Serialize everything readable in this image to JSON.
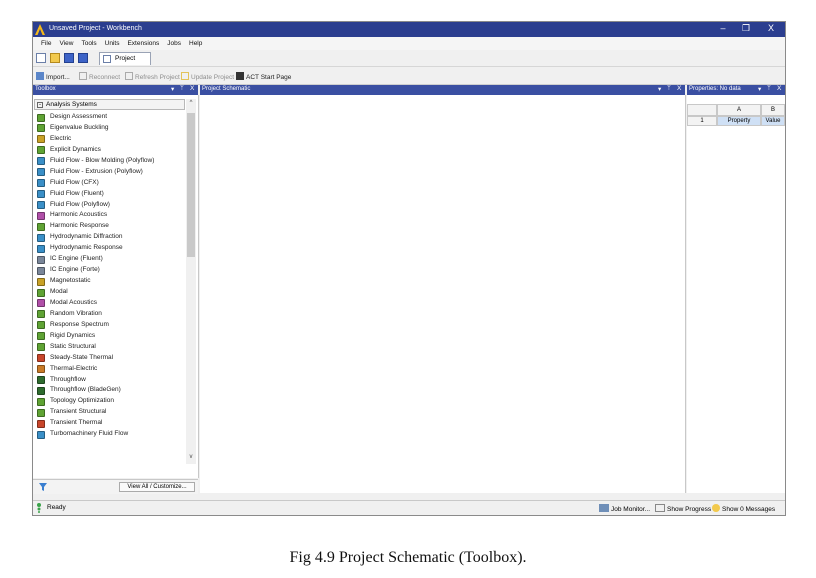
{
  "window": {
    "title": "Unsaved Project - Workbench",
    "controls": [
      "–",
      "❐",
      "X"
    ]
  },
  "menu": [
    "File",
    "View",
    "Tools",
    "Units",
    "Extensions",
    "Jobs",
    "Help"
  ],
  "tabs": {
    "project": "Project"
  },
  "toolbar": {
    "import": "Import...",
    "reconnect": "Reconnect",
    "refresh": "Refresh Project",
    "update": "Update Project",
    "act": "ACT Start Page"
  },
  "toolbox": {
    "title": "Toolbox",
    "pin": "ᛘ",
    "close": "X",
    "category": "Analysis Systems",
    "collapse": "-",
    "items": [
      {
        "label": "Design Assessment",
        "color": "#5fa334"
      },
      {
        "label": "Eigenvalue Buckling",
        "color": "#5fa334"
      },
      {
        "label": "Electric",
        "color": "#c9a227"
      },
      {
        "label": "Explicit Dynamics",
        "color": "#5fa334"
      },
      {
        "label": "Fluid Flow - Blow Molding (Polyflow)",
        "color": "#3a8fc7"
      },
      {
        "label": "Fluid Flow - Extrusion (Polyflow)",
        "color": "#3a8fc7"
      },
      {
        "label": "Fluid Flow (CFX)",
        "color": "#3a8fc7"
      },
      {
        "label": "Fluid Flow (Fluent)",
        "color": "#3a8fc7"
      },
      {
        "label": "Fluid Flow (Polyflow)",
        "color": "#3a8fc7"
      },
      {
        "label": "Harmonic Acoustics",
        "color": "#b04fa8"
      },
      {
        "label": "Harmonic Response",
        "color": "#5fa334"
      },
      {
        "label": "Hydrodynamic Diffraction",
        "color": "#3a8fc7"
      },
      {
        "label": "Hydrodynamic Response",
        "color": "#3a8fc7"
      },
      {
        "label": "IC Engine (Fluent)",
        "color": "#7a8699"
      },
      {
        "label": "IC Engine (Forte)",
        "color": "#7a8699"
      },
      {
        "label": "Magnetostatic",
        "color": "#c9a227"
      },
      {
        "label": "Modal",
        "color": "#5fa334"
      },
      {
        "label": "Modal Acoustics",
        "color": "#b04fa8"
      },
      {
        "label": "Random Vibration",
        "color": "#5fa334"
      },
      {
        "label": "Response Spectrum",
        "color": "#5fa334"
      },
      {
        "label": "Rigid Dynamics",
        "color": "#5fa334"
      },
      {
        "label": "Static Structural",
        "color": "#5fa334"
      },
      {
        "label": "Steady-State Thermal",
        "color": "#c8452a"
      },
      {
        "label": "Thermal-Electric",
        "color": "#c97a27"
      },
      {
        "label": "Throughflow",
        "color": "#2e6b2e"
      },
      {
        "label": "Throughflow (BladeGen)",
        "color": "#2e6b2e"
      },
      {
        "label": "Topology Optimization",
        "color": "#5fa334"
      },
      {
        "label": "Transient Structural",
        "color": "#5fa334"
      },
      {
        "label": "Transient Thermal",
        "color": "#c8452a"
      },
      {
        "label": "Turbomachinery Fluid Flow",
        "color": "#3a8fc7"
      }
    ],
    "view_all": "View All / Customize..."
  },
  "schematic": {
    "title": "Project Schematic",
    "pin": "ᛘ",
    "close": "X"
  },
  "properties": {
    "title": "Properties: No data",
    "pin": "ᛘ",
    "close": "X",
    "col_a": "A",
    "col_b": "B",
    "row_num": "1",
    "cell_property": "Property",
    "cell_value": "Value"
  },
  "status": {
    "ready": "Ready",
    "job_monitor": "Job Monitor...",
    "show_progress": "Show Progress",
    "show_messages": "Show 0 Messages"
  },
  "caption": "Fig 4.9 Project Schematic (Toolbox)."
}
